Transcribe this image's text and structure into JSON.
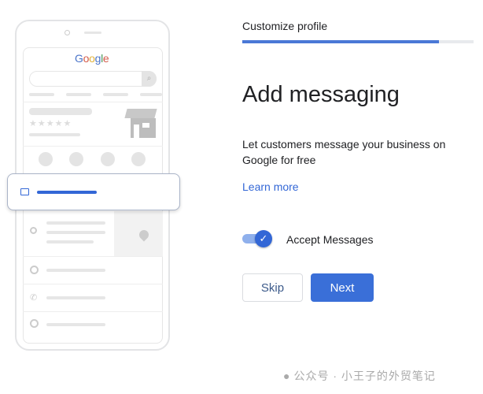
{
  "illustration": {
    "logo": "Google"
  },
  "header": {
    "step_title": "Customize profile",
    "progress_percent": 85
  },
  "main": {
    "title": "Add messaging",
    "description": "Let customers message your business on Google for free",
    "learn_more": "Learn more",
    "toggle": {
      "label": "Accept Messages",
      "checked": true
    },
    "skip_label": "Skip",
    "next_label": "Next"
  },
  "watermark": "公众号 · 小王子的外贸笔记",
  "colors": {
    "accent": "#3367d6",
    "progress_track": "#e8eaed"
  }
}
